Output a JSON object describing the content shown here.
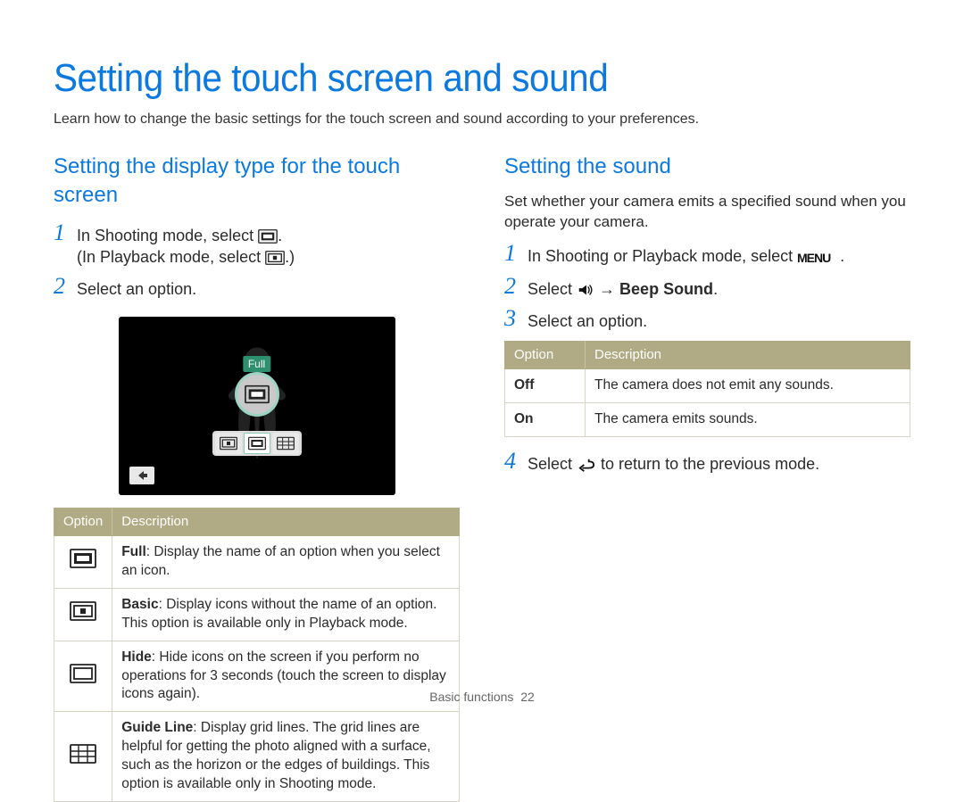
{
  "page_title": "Setting the touch screen and sound",
  "intro": "Learn how to change the basic settings for the touch screen and sound according to your preferences.",
  "footer_section": "Basic functions",
  "footer_page": "22",
  "left": {
    "section_title": "Setting the display type for the touch screen",
    "step1_a": "In Shooting mode, select ",
    "step1_b": "(In Playback mode, select ",
    "step1_end": ".)",
    "step2": "Select an option.",
    "sshot_label": "Full",
    "table": {
      "h_option": "Option",
      "h_desc": "Description",
      "rows": [
        {
          "icon": "full",
          "label": "Full",
          "desc": ": Display the name of an option when you select an icon."
        },
        {
          "icon": "basic",
          "label": "Basic",
          "desc": ": Display icons without the name of an option. This option is available only in Playback mode."
        },
        {
          "icon": "hide",
          "label": "Hide",
          "desc": ": Hide icons on the screen if you perform no operations for 3 seconds (touch the screen to display icons again)."
        },
        {
          "icon": "guide",
          "label": "Guide Line",
          "desc": ": Display grid lines. The grid lines are helpful for getting the photo aligned with a surface, such as the horizon or the edges of buildings. This option is available only in Shooting mode."
        }
      ]
    }
  },
  "right": {
    "section_title": "Setting the sound",
    "sub": "Set whether your camera emits a specified sound when you operate your camera.",
    "step1": "In Shooting or Playback mode, select ",
    "step2_a": "Select ",
    "step2_b": " → ",
    "step2_c": "Beep Sound",
    "step2_d": ".",
    "step3": "Select an option.",
    "step4_a": "Select ",
    "step4_b": " to return to the previous mode.",
    "table": {
      "h_option": "Option",
      "h_desc": "Description",
      "rows": [
        {
          "opt": "Off",
          "desc": "The camera does not emit any sounds."
        },
        {
          "opt": "On",
          "desc": "The camera emits sounds."
        }
      ]
    }
  }
}
